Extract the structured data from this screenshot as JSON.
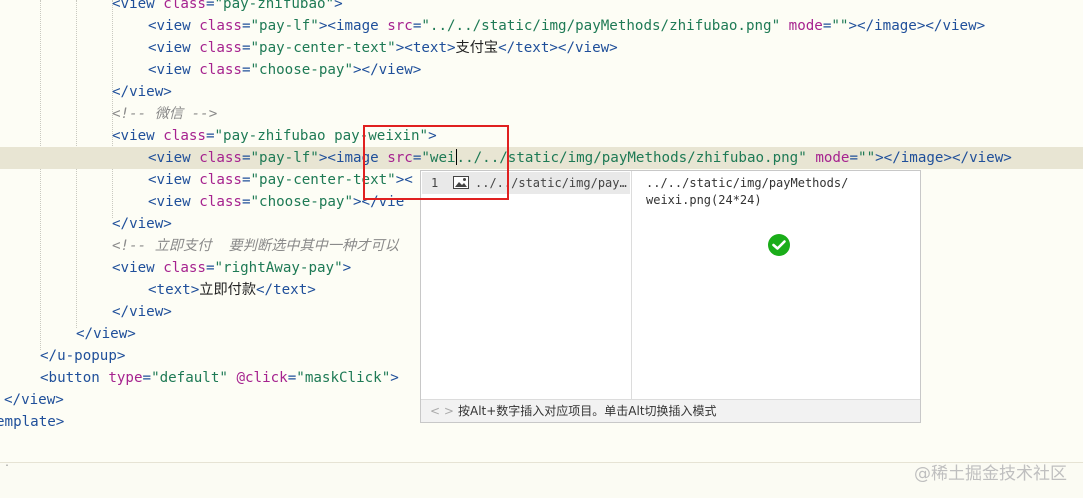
{
  "editor": {
    "lines": [
      {
        "a": "<view ",
        "b": "class",
        "c": "=",
        "d": "\"pay-zhifubao\"",
        "e": ">"
      },
      {
        "a": "<view ",
        "b": "class",
        "c": "=",
        "d": "\"pay-lf\"",
        "e": "><image ",
        "f": "src",
        "g": "=",
        "h": "\"../../static/img/payMethods/zhifubao.png\"",
        "i": " ",
        "j": "mode",
        "k": "=",
        "l": "\"\"",
        "m": "></image></view>"
      },
      {
        "a": "<view ",
        "b": "class",
        "c": "=",
        "d": "\"pay-center-text\"",
        "e": "><text>",
        "f": "支付宝",
        "g": "</text></view>"
      },
      {
        "a": "<view ",
        "b": "class",
        "c": "=",
        "d": "\"choose-pay\"",
        "e": "></view>"
      },
      {
        "a": "</view>"
      },
      {
        "a": "<!-- 微信 -->"
      },
      {
        "a": "<view ",
        "b": "class",
        "c": "=",
        "d": "\"pay-zhifubao pay-weixin\"",
        "e": ">"
      },
      {
        "a": "<view ",
        "b": "class",
        "c": "=",
        "d": "\"pay-lf\"",
        "e": "><image ",
        "f": "src",
        "g": "=",
        "h": "\"wei",
        "h2": "../../static/img/payMethods/zhifubao.png\"",
        "i": " ",
        "j": "mode",
        "k": "=",
        "l": "\"\"",
        "m": "></image></view>"
      },
      {
        "a": "<view ",
        "b": "class",
        "c": "=",
        "d": "\"pay-center-text\"",
        "e": "><"
      },
      {
        "a": "<view ",
        "b": "class",
        "c": "=",
        "d": "\"choose-pay\"",
        "e": "></vie"
      },
      {
        "a": "</view>"
      },
      {
        "a": "<!-- 立即支付  要判断选中其中一种才可以"
      },
      {
        "a": "<view ",
        "b": "class",
        "c": "=",
        "d": "\"rightAway-pay\"",
        "e": ">"
      },
      {
        "a": "<text>",
        "b": "立即付款",
        "c": "</text>"
      },
      {
        "a": "</view>"
      },
      {
        "a": "</view>"
      },
      {
        "a": "</u-popup>"
      },
      {
        "a": "<button ",
        "b": "type",
        "c": "=",
        "d": "\"default\"",
        "e": " @click",
        "f": "=",
        "g": "\"maskClick\"",
        "h": ">"
      },
      {
        "a": "</view>"
      },
      {
        "a": "emplate>"
      }
    ]
  },
  "autocomplete": {
    "item": {
      "index": "1",
      "icon": "image-file-icon",
      "path": "../../static/img/pay…"
    },
    "preview": {
      "path_line1": "../../static/img/payMethods/",
      "path_line2": "weixi.png(24*24)"
    },
    "footer": {
      "nav": "< >",
      "hint": "按Alt+数字插入对应项目。单击Alt切换插入模式"
    }
  },
  "watermark": "@稀土掘金技术社区",
  "colors": {
    "highlight": "#e02020",
    "wechat": "#1aad19",
    "tag": "#1f4f9a",
    "attr": "#a6238f",
    "value": "#1e7a55"
  }
}
